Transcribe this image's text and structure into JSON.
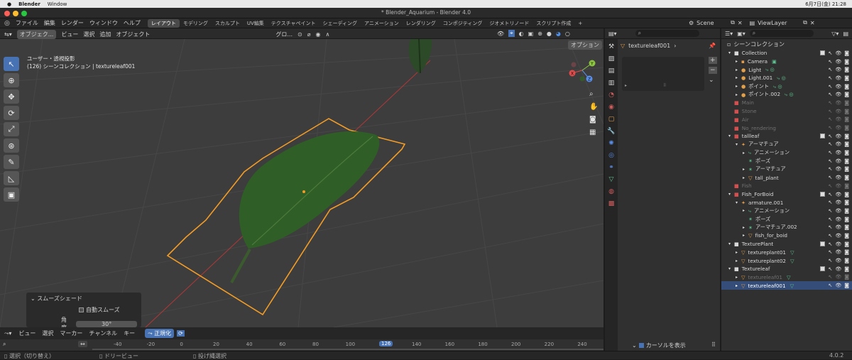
{
  "macbar": {
    "app": "Blender",
    "menu_window": "Window",
    "clock": "6月7日(金) 21:28"
  },
  "window": {
    "title": "* Blender_Aquarium - Blender 4.0"
  },
  "topbar": {
    "menus": [
      "ファイル",
      "編集",
      "レンダー",
      "ウィンドウ",
      "ヘルプ"
    ],
    "workspaces": [
      "レイアウト",
      "モデリング",
      "スカルプト",
      "UV編集",
      "テクスチャペイント",
      "シェーディング",
      "アニメーション",
      "レンダリング",
      "コンポジティング",
      "ジオメトリノード",
      "スクリプト作成"
    ],
    "scene": "Scene",
    "viewlayer": "ViewLayer"
  },
  "viewport": {
    "mode": "オブジェク...",
    "menu_view": "ビュー",
    "menu_select": "選択",
    "menu_add": "追加",
    "menu_object": "オブジェクト",
    "orientation": "グロ...",
    "options": "オプション",
    "info_line1": "ユーザー・透視投影",
    "info_line2": "(126) シーンコレクション | textureleaf001",
    "gizmo": {
      "y": "Y",
      "x": "X",
      "z": "Z"
    }
  },
  "last_op": {
    "title": "スムーズシェード",
    "auto_smooth": "自動スムーズ",
    "angle_label": "角度",
    "angle_value": "30°"
  },
  "timeline": {
    "menus": [
      "ビュー",
      "選択",
      "マーカー",
      "チャンネル",
      "キー"
    ],
    "normalize": "正規化",
    "ticks": [
      "-40",
      "-20",
      "0",
      "20",
      "40",
      "60",
      "80",
      "100",
      "120",
      "140",
      "160",
      "180",
      "200",
      "220",
      "240",
      "260"
    ],
    "current_frame": "126"
  },
  "status": {
    "select": "選択（切り替え）",
    "drag": "ドリービュー",
    "lasso": "投げ縄選択",
    "version": "4.0.2"
  },
  "properties": {
    "object_name": "textureleaf001",
    "show_cursor": "カーソルを表示"
  },
  "outliner": {
    "header": "シーンコレクション",
    "rows": [
      {
        "indent": 1,
        "exp": "▾",
        "icon": "■",
        "color": "#d8d8d8",
        "label": "Collection",
        "chk": true
      },
      {
        "indent": 2,
        "exp": "▸",
        "icon": "▪",
        "color": "#e39c4a",
        "label": "Camera",
        "tag": "▣",
        "tagc": "#5cc28f"
      },
      {
        "indent": 2,
        "exp": "▸",
        "icon": "●",
        "color": "#e3a04a",
        "label": "Light",
        "tag": "⤷ ◎",
        "tagc": "#5cc28f"
      },
      {
        "indent": 2,
        "exp": "▸",
        "icon": "●",
        "color": "#e3a04a",
        "label": "Light.001",
        "tag": "⤷ ◎",
        "tagc": "#5cc28f"
      },
      {
        "indent": 2,
        "exp": "▸",
        "icon": "●",
        "color": "#e3a04a",
        "label": "ポイント",
        "tag": "⤷ ◎",
        "tagc": "#5cc28f"
      },
      {
        "indent": 2,
        "exp": "▸",
        "icon": "●",
        "color": "#e3a04a",
        "label": "ポイント.002",
        "tag": "⤷ ◎",
        "tagc": "#5cc28f"
      },
      {
        "indent": 1,
        "exp": "",
        "icon": "■",
        "color": "#d25050",
        "label": "Main",
        "dim": true
      },
      {
        "indent": 1,
        "exp": "",
        "icon": "■",
        "color": "#d25050",
        "label": "Stone",
        "dim": true
      },
      {
        "indent": 1,
        "exp": "",
        "icon": "■",
        "color": "#d25050",
        "label": "Air",
        "dim": true
      },
      {
        "indent": 1,
        "exp": "",
        "icon": "■",
        "color": "#d25050",
        "label": "No_rendering",
        "dim": true
      },
      {
        "indent": 1,
        "exp": "▾",
        "icon": "■",
        "color": "#d25050",
        "label": "tallleaf",
        "chk": true
      },
      {
        "indent": 2,
        "exp": "▾",
        "icon": "✦",
        "color": "#e39c4a",
        "label": "アーマチュア"
      },
      {
        "indent": 3,
        "exp": "▸",
        "icon": "⤷",
        "color": "#5cc28f",
        "label": "アニメーション"
      },
      {
        "indent": 3,
        "exp": "",
        "icon": "✶",
        "color": "#5cc28f",
        "label": "ポーズ"
      },
      {
        "indent": 3,
        "exp": "▸",
        "icon": "✶",
        "color": "#5cc28f",
        "label": "アーマチュア"
      },
      {
        "indent": 3,
        "exp": "▸",
        "icon": "▽",
        "color": "#e39c4a",
        "label": "tall_plant"
      },
      {
        "indent": 1,
        "exp": "",
        "icon": "■",
        "color": "#d25050",
        "label": "Fish",
        "dim": true
      },
      {
        "indent": 1,
        "exp": "▾",
        "icon": "■",
        "color": "#d25050",
        "label": "Fish_ForBoid",
        "chk": true
      },
      {
        "indent": 2,
        "exp": "▾",
        "icon": "✦",
        "color": "#e39c4a",
        "label": "armature.001"
      },
      {
        "indent": 3,
        "exp": "▸",
        "icon": "⤷",
        "color": "#5cc28f",
        "label": "アニメーション"
      },
      {
        "indent": 3,
        "exp": "",
        "icon": "✶",
        "color": "#5cc28f",
        "label": "ポーズ"
      },
      {
        "indent": 3,
        "exp": "▸",
        "icon": "✶",
        "color": "#5cc28f",
        "label": "アーマチュア.002"
      },
      {
        "indent": 3,
        "exp": "▸",
        "icon": "▽",
        "color": "#e39c4a",
        "label": "fish_for_boid"
      },
      {
        "indent": 1,
        "exp": "▾",
        "icon": "■",
        "color": "#d8d8d8",
        "label": "TexturePlant",
        "chk": true
      },
      {
        "indent": 2,
        "exp": "▸",
        "icon": "▽",
        "color": "#e39c4a",
        "label": "textureplant01",
        "tag": "▽",
        "tagc": "#5cc28f"
      },
      {
        "indent": 2,
        "exp": "▸",
        "icon": "▽",
        "color": "#e39c4a",
        "label": "textureplant02",
        "tag": "▽",
        "tagc": "#5cc28f"
      },
      {
        "indent": 1,
        "exp": "▾",
        "icon": "■",
        "color": "#d8d8d8",
        "label": "Textureleaf",
        "chk": true
      },
      {
        "indent": 2,
        "exp": "▸",
        "icon": "▽",
        "color": "#e39c4a",
        "label": "textureleaf01",
        "tag": "▽",
        "tagc": "#5cc28f",
        "dim": true
      },
      {
        "indent": 2,
        "exp": "▸",
        "icon": "▽",
        "color": "#e39c4a",
        "label": "textureleaf001",
        "tag": "▽",
        "tagc": "#5cc28f",
        "sel": true
      }
    ]
  }
}
